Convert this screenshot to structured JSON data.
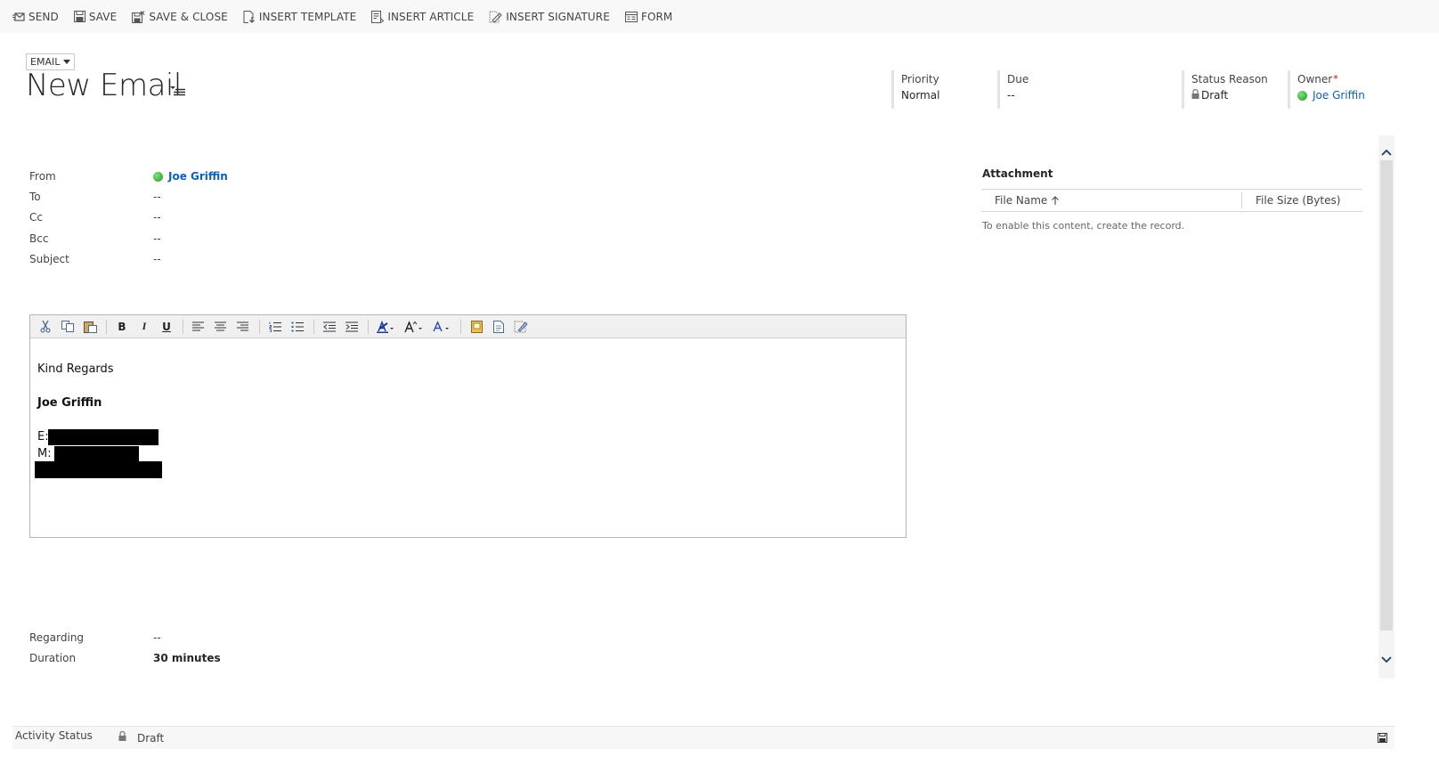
{
  "command_bar": {
    "send": "SEND",
    "save": "SAVE",
    "save_close": "SAVE & CLOSE",
    "insert_template": "INSERT TEMPLATE",
    "insert_article": "INSERT ARTICLE",
    "insert_signature": "INSERT SIGNATURE",
    "form": "FORM"
  },
  "header": {
    "entity_selector": "EMAIL",
    "title": "New Email",
    "priority_label": "Priority",
    "priority_value": "Normal",
    "due_label": "Due",
    "due_value": "--",
    "status_reason_label": "Status Reason",
    "status_reason_value": "Draft",
    "owner_label": "Owner",
    "owner_required": "*",
    "owner_value": "Joe Griffin"
  },
  "fields": {
    "from_label": "From",
    "from_value": "Joe Griffin",
    "to_label": "To",
    "to_value": "--",
    "cc_label": "Cc",
    "cc_value": "--",
    "bcc_label": "Bcc",
    "bcc_value": "--",
    "subject_label": "Subject",
    "subject_value": "--",
    "regarding_label": "Regarding",
    "regarding_value": "--",
    "duration_label": "Duration",
    "duration_value": "30 minutes"
  },
  "editor": {
    "toolbar": [
      "cut-icon",
      "copy-icon",
      "paste-icon",
      "bold-icon",
      "italic-icon",
      "underline-icon",
      "align-left-icon",
      "align-center-icon",
      "align-right-icon",
      "numbered-list-icon",
      "bullet-list-icon",
      "decrease-indent-icon",
      "increase-indent-icon",
      "highlight-icon",
      "font-size-icon",
      "font-color-icon",
      "image-icon",
      "source-icon",
      "clean-format-icon"
    ],
    "bold_glyph": "B",
    "italic_glyph": "I",
    "underline_glyph": "U",
    "closing": "Kind Regards",
    "signature_name": "Joe Griffin",
    "email_prefix": "E:",
    "mobile_prefix": "M:"
  },
  "attachment": {
    "title": "Attachment",
    "col_file_name": "File Name",
    "col_file_size": "File Size (Bytes)",
    "empty_message": "To enable this content, create the record."
  },
  "footer": {
    "label": "Activity Status",
    "value": "Draft"
  },
  "colors": {
    "link": "#1160b7",
    "required": "#d40000",
    "presence": "#2fae2f"
  }
}
